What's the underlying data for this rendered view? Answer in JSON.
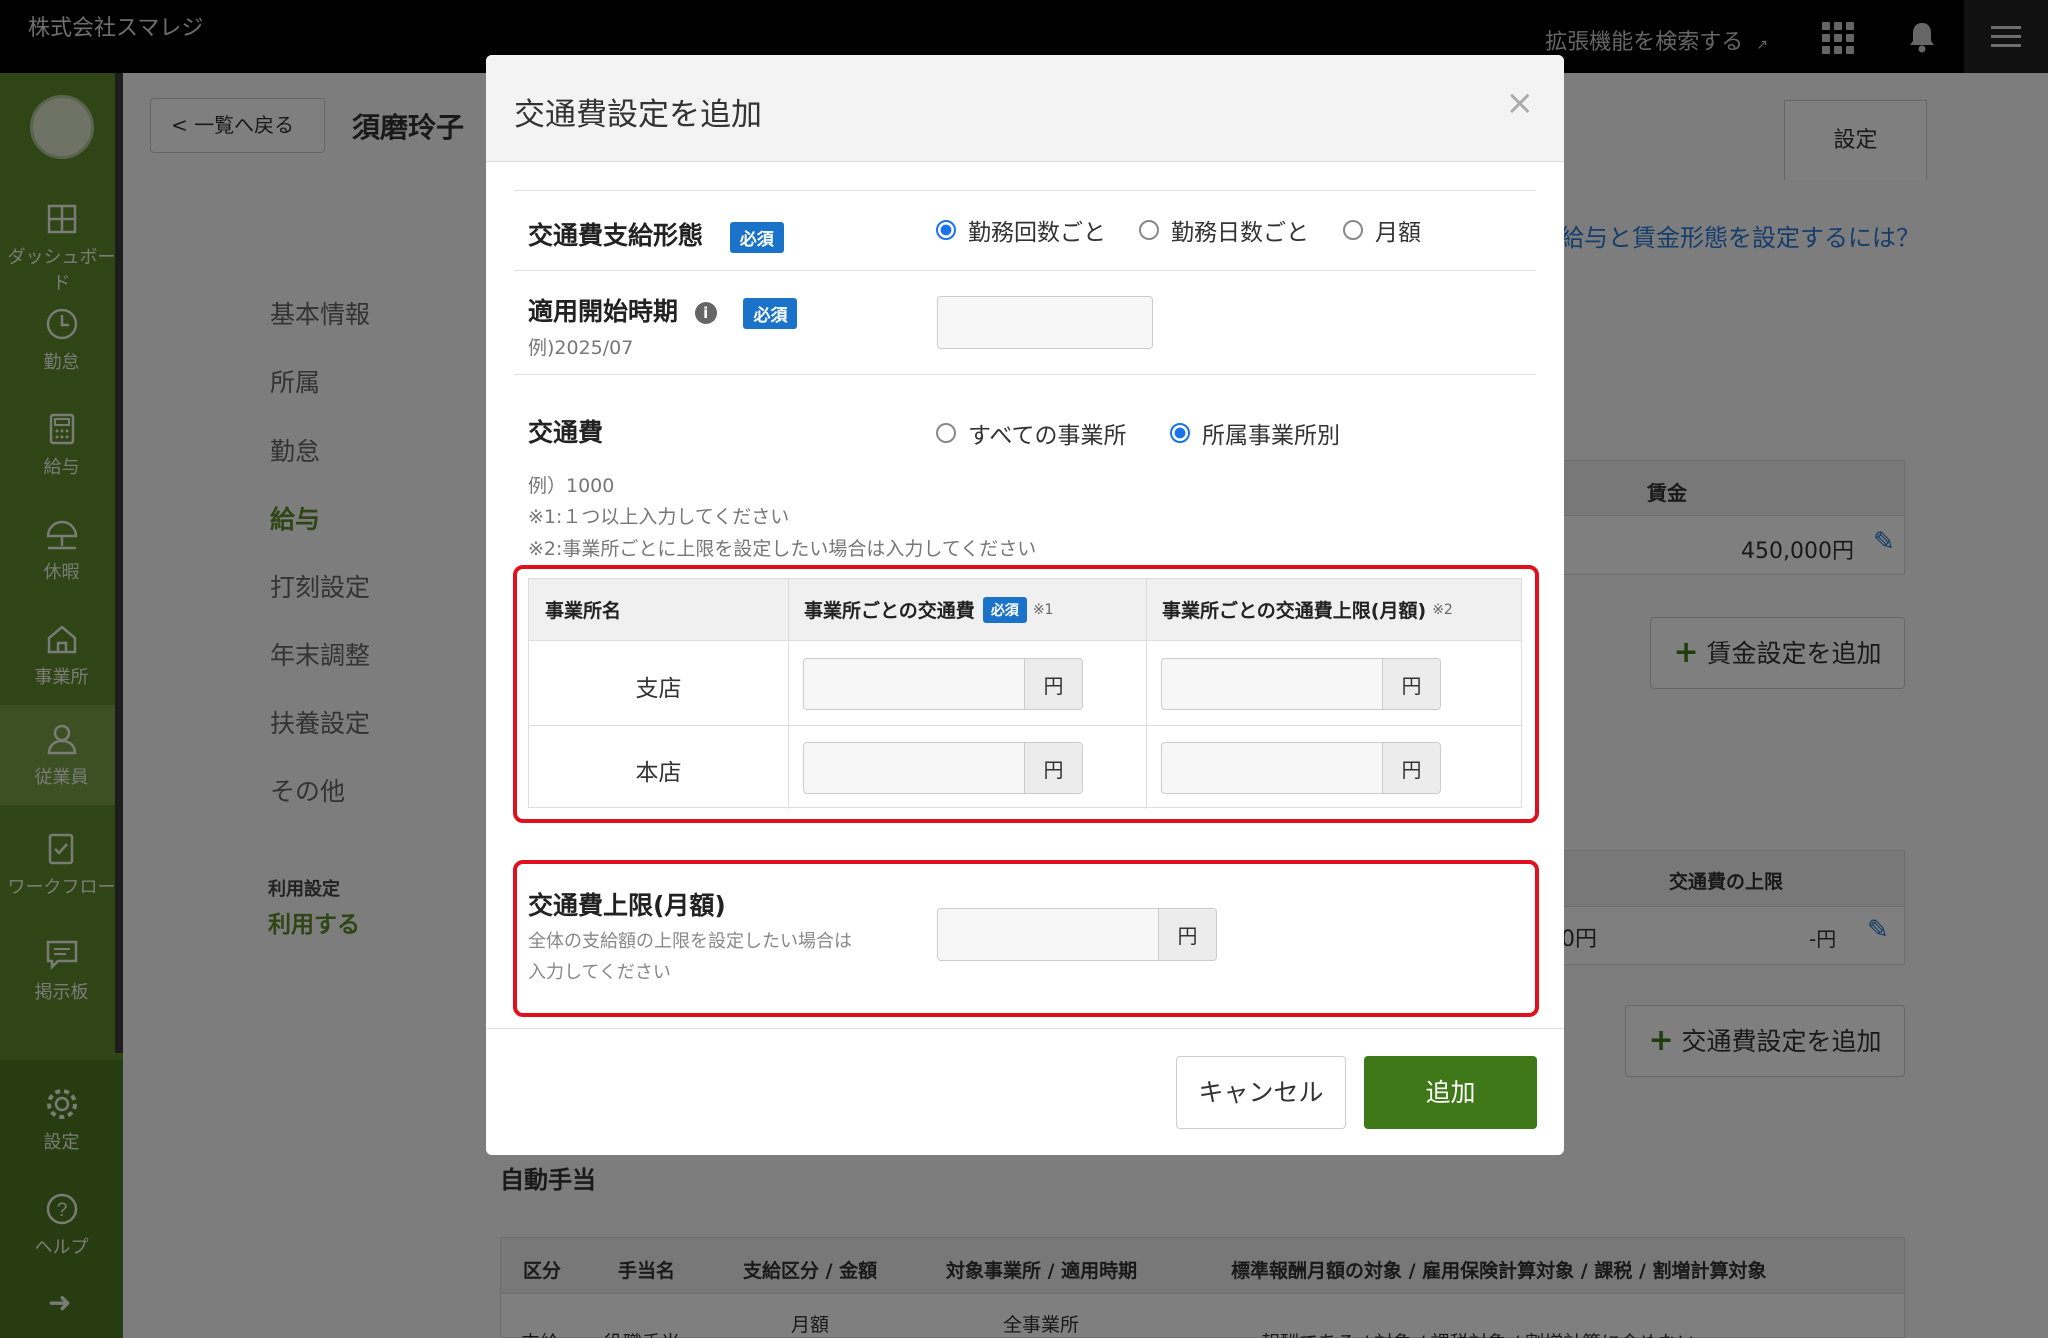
{
  "topbar": {
    "company": "株式会社スマレジ",
    "ext_search": "拡張機能を検索する",
    "ext_icon": "external-link-icon"
  },
  "sidebar": {
    "items": [
      {
        "label": "ダッシュボード",
        "icon": "dashboard-icon"
      },
      {
        "label": "勤怠",
        "icon": "clock-icon"
      },
      {
        "label": "給与",
        "icon": "calculator-icon"
      },
      {
        "label": "休暇",
        "icon": "umbrella-icon"
      },
      {
        "label": "事業所",
        "icon": "home-icon"
      },
      {
        "label": "従業員",
        "icon": "person-icon"
      },
      {
        "label": "ワークフロー",
        "icon": "checklist-icon"
      },
      {
        "label": "掲示板",
        "icon": "chat-icon"
      },
      {
        "label": "設定",
        "icon": "gear-icon"
      },
      {
        "label": "ヘルプ",
        "icon": "help-icon"
      }
    ]
  },
  "page": {
    "back_label": "一覧へ戻る",
    "employee_name": "須磨玲子",
    "settings_tab": "設定",
    "nav": [
      "基本情報",
      "所属",
      "勤怠",
      "給与",
      "打刻設定",
      "年末調整",
      "扶養設定",
      "その他"
    ],
    "nav_active": "給与",
    "usage_label": "利用設定",
    "usage_value": "利用する",
    "help_link": "給与と賃金形態を設定するには？",
    "wage_header": "賃金",
    "wage_value": "450,000円",
    "add_wage_button": "賃金設定を追加",
    "transport_limit_header": "交通費の上限",
    "transport_left_value": "0円",
    "transport_limit_value": "-円",
    "add_transport_button": "交通費設定を追加",
    "auto_allowance_title": "自動手当",
    "allowance_headers": [
      "区分",
      "手当名",
      "支給区分 / 金額",
      "対象事業所 / 適用時期",
      "標準報酬月額の対象 / 雇用保険計算対象 / 課税 / 割増計算対象"
    ],
    "allowance_row": [
      "支給",
      "役職手当",
      "月額",
      "全事業所",
      "報酬である / 対象 / 課税対象 / 割増計算に含めない"
    ]
  },
  "modal": {
    "title": "交通費設定を追加",
    "close_icon": "close-icon",
    "payment_type_label": "交通費支給形態",
    "required_badge": "必須",
    "payment_options": [
      "勤務回数ごと",
      "勤務日数ごと",
      "月額"
    ],
    "payment_selected": "勤務回数ごと",
    "start_label": "適用開始時期",
    "start_hint": "例)2025/07",
    "start_value": "",
    "transport_label": "交通費",
    "scope_options": [
      "すべての事業所",
      "所属事業所別"
    ],
    "scope_selected": "所属事業所別",
    "notes": [
      "例）1000",
      "※1:１つ以上入力してください",
      "※2:事業所ごとに上限を設定したい場合は入力してください"
    ],
    "table_headers": {
      "office": "事業所名",
      "fee": "事業所ごとの交通費",
      "fee_badge": "必須",
      "fee_note": "※1",
      "limit": "事業所ごとの交通費上限(月額)",
      "limit_note": "※2"
    },
    "offices": [
      {
        "name": "支店",
        "fee": "",
        "limit": ""
      },
      {
        "name": "本店",
        "fee": "",
        "limit": ""
      }
    ],
    "unit": "円",
    "cap_label": "交通費上限(月額)",
    "cap_desc_1": "全体の支給額の上限を設定したい場合は",
    "cap_desc_2": "入力してください",
    "cap_value": "",
    "cancel_button": "キャンセル",
    "submit_button": "追加"
  },
  "colors": {
    "sidebar": "#5e8a2c",
    "primary_button": "#3f7818",
    "required_badge": "#1a73c9",
    "highlight_box": "#e0101e"
  }
}
